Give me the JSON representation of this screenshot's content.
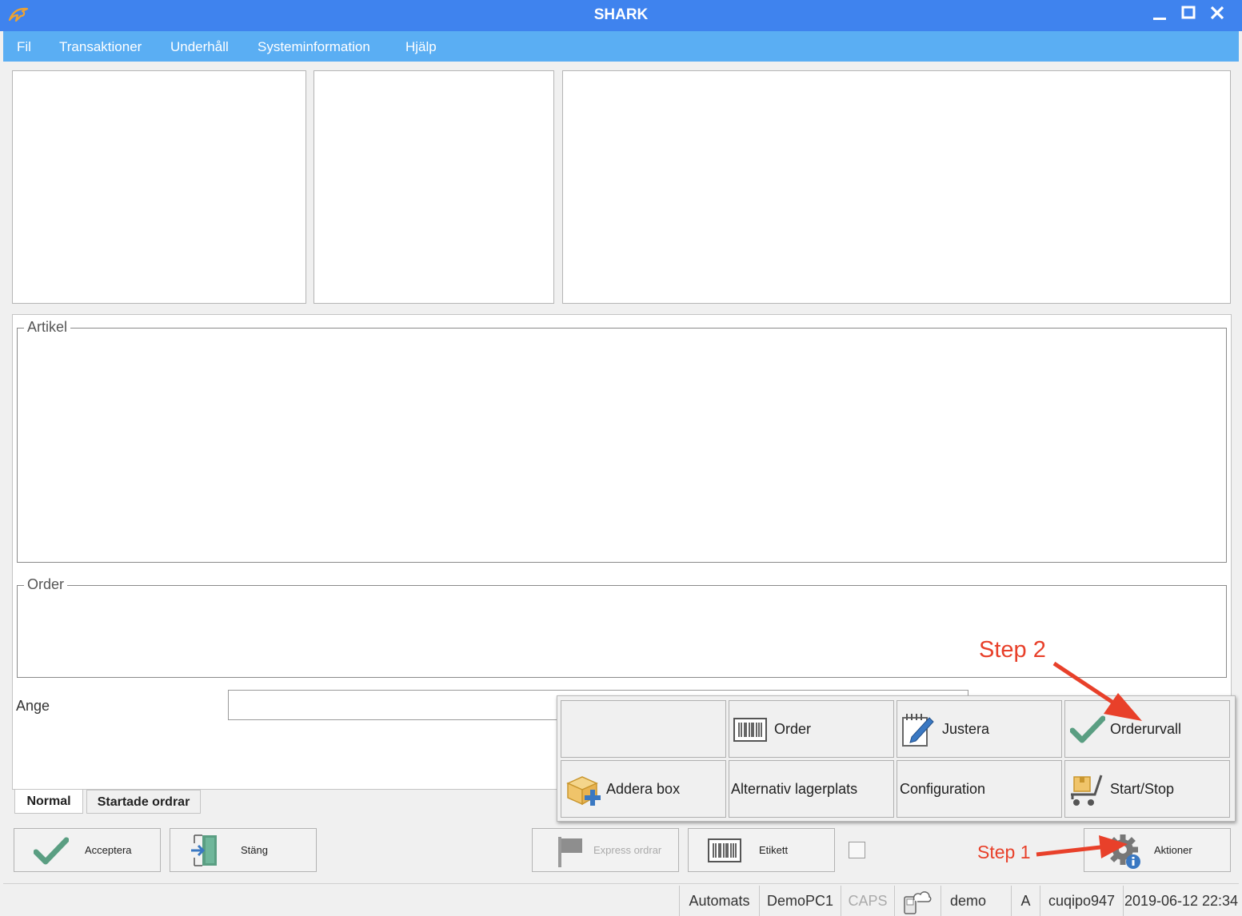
{
  "window": {
    "title": "SHARK"
  },
  "colors": {
    "titlebar": "#3f83ee",
    "menubar": "#5aaef3",
    "logo": "#f0a22e",
    "annotation": "#e8402a",
    "check_green": "#5a9e82"
  },
  "menu": [
    "Fil",
    "Transaktioner",
    "Underhåll",
    "Systeminformation",
    "Hjälp"
  ],
  "groups": {
    "artikel": "Artikel",
    "order": "Order"
  },
  "input": {
    "ange_label": "Ange",
    "ange_value": ""
  },
  "tabs": [
    "Normal",
    "Startade ordrar"
  ],
  "buttons": {
    "acceptera": "Acceptera",
    "stang": "Stäng",
    "express": "Express ordrar",
    "etikett": "Etikett",
    "aktioner": "Aktioner"
  },
  "actions_popup": {
    "order": "Order",
    "justera": "Justera",
    "orderurvall": "Orderurvall",
    "addera_box": "Addera box",
    "alternativ_lagerplats": "Alternativ lagerplats",
    "configuration": "Configuration",
    "start_stop": "Start/Stop"
  },
  "annotations": {
    "step1": "Step 1",
    "step2": "Step 2"
  },
  "status": {
    "mode": "Automats",
    "pc": "DemoPC1",
    "caps": "CAPS",
    "user": "demo",
    "level": "A",
    "login": "cuqipo947",
    "datetime": "2019-06-12 22:34"
  },
  "icons": [
    "app-logo-icon",
    "minimize-icon",
    "maximize-icon",
    "close-icon",
    "checkmark-icon",
    "exit-door-icon",
    "flag-icon",
    "barcode-icon",
    "gear-info-icon",
    "edit-pencil-icon",
    "box-add-icon",
    "cart-icon",
    "phone-cloud-icon"
  ]
}
